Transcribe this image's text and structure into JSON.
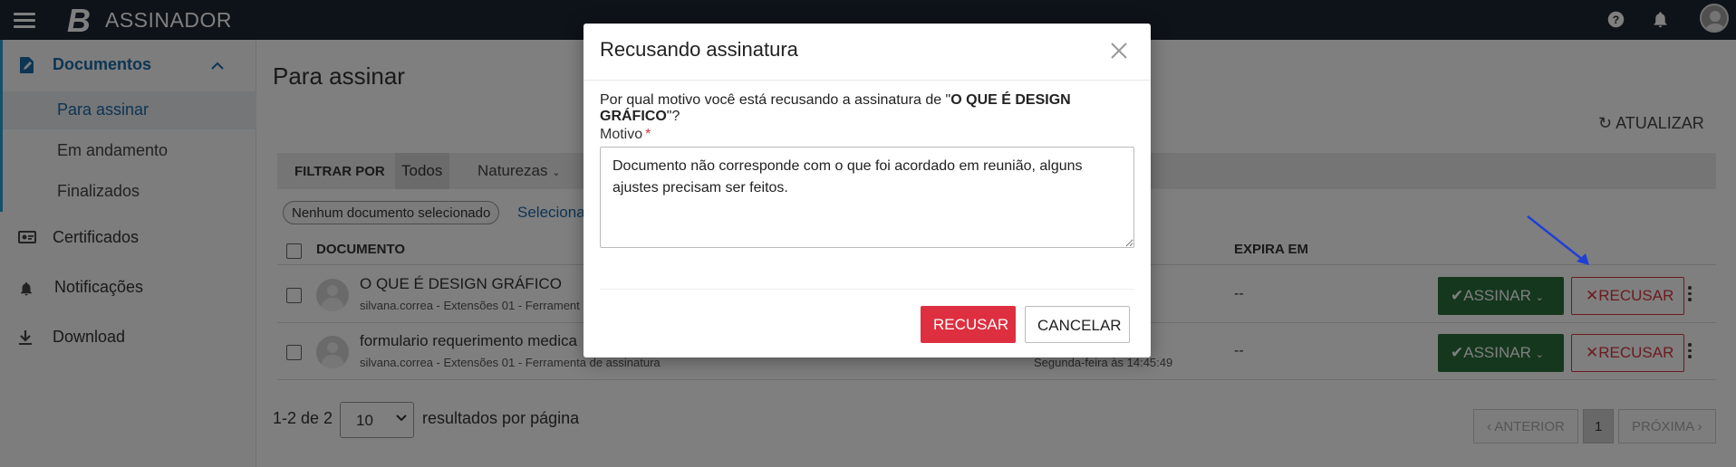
{
  "topbar": {
    "logo": "B",
    "title": "ASSINADOR",
    "menu_icon": "hamburger-menu-icon",
    "help_icon": "help-icon",
    "notifications_icon": "bell-icon"
  },
  "sidebar": {
    "group": {
      "label": "Documentos",
      "items": [
        {
          "label": "Para assinar",
          "active": true
        },
        {
          "label": "Em andamento"
        },
        {
          "label": "Finalizados"
        }
      ]
    },
    "items": [
      {
        "label": "Certificados",
        "icon": "certificate-icon"
      },
      {
        "label": "Notificações",
        "icon": "bell-icon"
      },
      {
        "label": "Download",
        "icon": "download-icon"
      }
    ]
  },
  "main": {
    "title": "Para assinar",
    "refresh_label": "ATUALIZAR",
    "filter": {
      "label": "FILTRAR POR",
      "all": "Todos",
      "nature": "Naturezas"
    },
    "selection": {
      "badge": "Nenhum documento selecionado",
      "link": "Seleciona"
    },
    "table": {
      "headers": {
        "document": "DOCUMENTO",
        "expires": "EXPIRA EM"
      },
      "rows": [
        {
          "title": "O QUE É DESIGN GRÁFICO",
          "subtitle": "silvana.correa - Extensões 01 - Ferrament",
          "date": "",
          "expires": "--"
        },
        {
          "title": "formulario requerimento medica",
          "subtitle": "silvana.correa - Extensões 01 - Ferramenta de assinatura",
          "date": "Segunda-feira às 14:45:49",
          "expires": "--"
        }
      ],
      "sign_label": "ASSINAR",
      "refuse_label": "RECUSAR"
    },
    "pagination": {
      "range": "1-2 de 2",
      "per_page": "10",
      "per_page_label": "resultados por página",
      "prev": "ANTERIOR",
      "current": "1",
      "next": "PRÓXIMA"
    }
  },
  "modal": {
    "title": "Recusando assinatura",
    "question_prefix": "Por qual motivo você está recusando a assinatura de \"",
    "question_doc": "O QUE É DESIGN GRÁFICO",
    "question_suffix": "\"?",
    "field_label": "Motivo",
    "required_mark": "*",
    "reason": "Documento não corresponde com o que foi acordado em reunião, alguns ajustes precisam ser feitos.",
    "refuse_button": "RECUSAR",
    "cancel_button": "CANCELAR"
  },
  "colors": {
    "topbar": "#1c2433",
    "accent": "#1a6aa8",
    "sign_green": "#2b6e3c",
    "refuse_red": "#dd2f3f",
    "annotation_arrow": "#1f3fd6"
  }
}
